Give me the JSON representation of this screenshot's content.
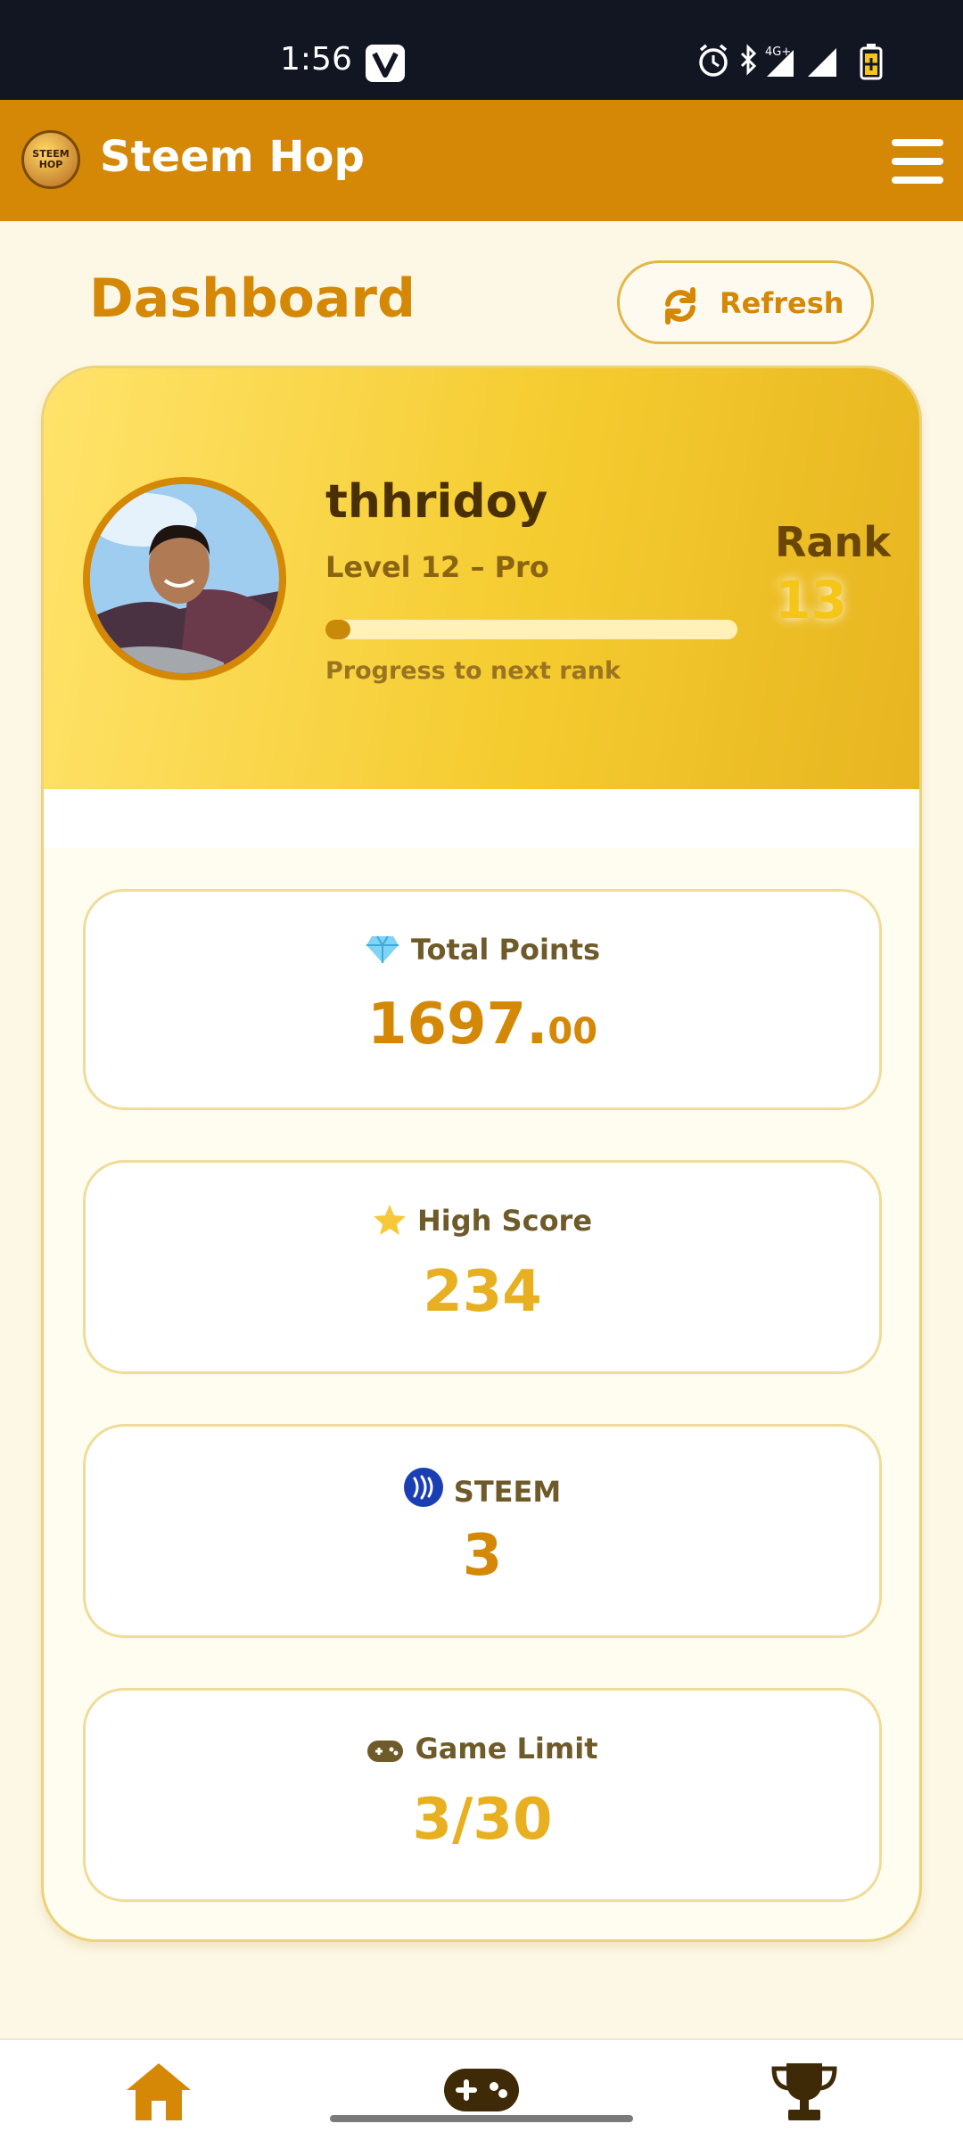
{
  "status_bar": {
    "time": "1:56",
    "network": "4G+"
  },
  "app": {
    "title": "Steem Hop",
    "logo_text": "STEEM HOP"
  },
  "dashboard": {
    "title": "Dashboard",
    "refresh_label": "Refresh"
  },
  "profile": {
    "username": "thhridoy",
    "level": "Level 12 – Pro",
    "progress_label": "Progress to next rank",
    "progress_fraction": 0.06,
    "rank_label": "Rank",
    "rank_value": "13"
  },
  "stats": {
    "total_points": {
      "label": "Total Points",
      "value_main": "1697.",
      "value_decimal": "00",
      "icon": "diamond-icon",
      "color": "#d48806"
    },
    "high_score": {
      "label": "High Score",
      "value": "234",
      "icon": "star-icon",
      "color": "#e8b020"
    },
    "steem": {
      "label": "STEEM",
      "value": "3",
      "icon": "steem-icon",
      "color": "#d48806"
    },
    "game_limit": {
      "label": "Game Limit",
      "value": "3/30",
      "icon": "gamepad-icon",
      "color": "#e8b020"
    }
  },
  "bottom_nav": {
    "items": [
      {
        "icon": "home-icon",
        "active": true
      },
      {
        "icon": "gamepad-icon",
        "active": false
      },
      {
        "icon": "trophy-icon",
        "active": false
      }
    ]
  },
  "colors": {
    "brand": "#d48806",
    "header_bg": "#d48806",
    "status_bar_bg": "#121522",
    "page_bg": "#fdf8e6"
  }
}
